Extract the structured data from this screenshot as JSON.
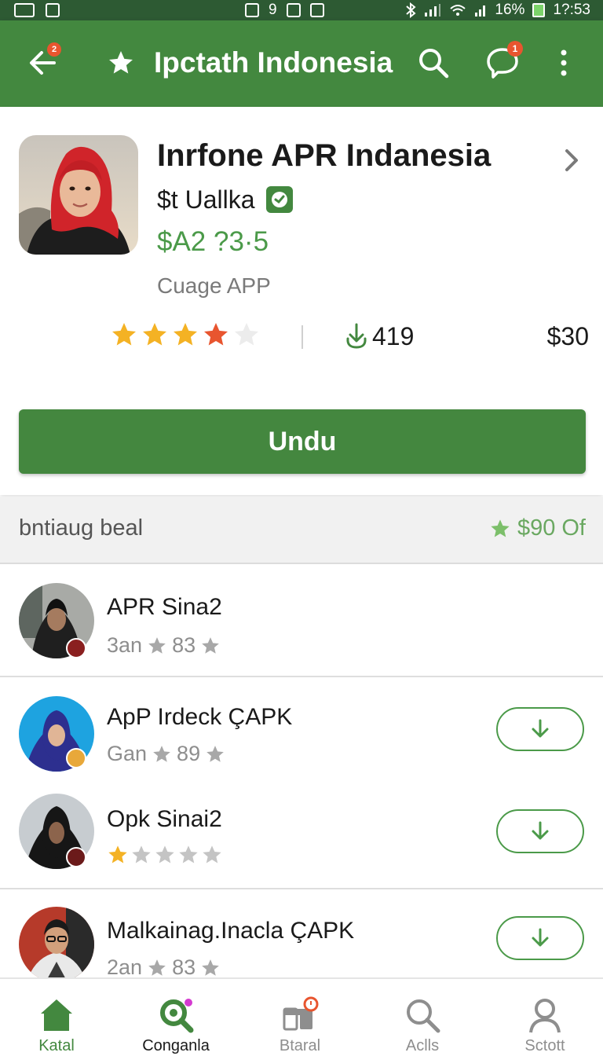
{
  "status_bar": {
    "signal_text": "9",
    "battery_percent": "16%",
    "time": "1?:53"
  },
  "app_bar": {
    "title": "Ipctath Indonesia",
    "back_badge": "2",
    "chat_badge": "1",
    "icons": [
      "back-arrow-icon",
      "star-icon",
      "search-icon",
      "chat-bubble-icon",
      "more-vert-icon"
    ]
  },
  "app": {
    "name": "Inrfone APR Indanesia",
    "developer": "$t Uallka",
    "price": "$A2 ?3·5",
    "category": "Cuage APP",
    "rating_stars": 3.8,
    "downloads": "419",
    "size": "$30",
    "install_label": "Undu"
  },
  "section": {
    "title": "bntiaug beal",
    "meta": "$90  Of"
  },
  "list": [
    {
      "title": "APR Sina2",
      "meta_prefix": "3an",
      "meta_value": "83",
      "has_download": false
    },
    {
      "title": "ApP Irdeck ÇAPK",
      "meta_prefix": "Gan",
      "meta_value": "89",
      "has_download": true
    },
    {
      "title": "Opk Sinai2",
      "meta_prefix": "",
      "meta_value": "",
      "rating_stars": 1,
      "has_download": true
    },
    {
      "title": "Malkainag.Inacla ÇAPK",
      "meta_prefix": "2an",
      "meta_value": "83",
      "has_download": true
    }
  ],
  "bottom_nav": [
    {
      "label": "Katal",
      "icon": "home-icon",
      "active": true
    },
    {
      "label": "Conganla",
      "icon": "search-apps-icon",
      "active": false
    },
    {
      "label": "Btaral",
      "icon": "library-icon",
      "active": false
    },
    {
      "label": "Aclls",
      "icon": "search-icon",
      "active": false
    },
    {
      "label": "Sctott",
      "icon": "profile-icon",
      "active": false
    }
  ],
  "colors": {
    "primary": "#43883f",
    "status_bar": "#2d5a33",
    "accent_green_text": "#4b9a49",
    "badge": "#e8552f",
    "star_gold": "#f4b224",
    "star_red": "#e8552f"
  }
}
